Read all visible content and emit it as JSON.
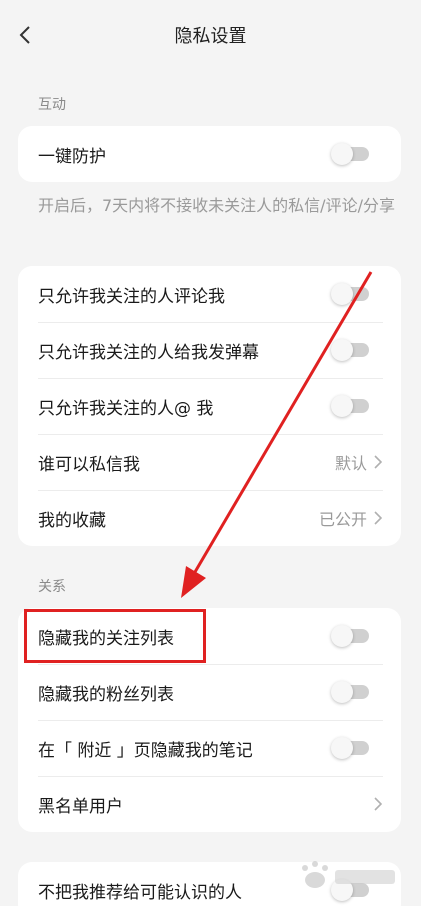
{
  "header": {
    "title": "隐私设置",
    "back_icon": "chevron-left-icon"
  },
  "sections": {
    "interaction_label": "互动",
    "relation_label": "关系"
  },
  "one_key_card": {
    "one_key_label": "一键防护"
  },
  "hint_text": "开启后，7天内将不接收未关注人的私信/评论/分享",
  "interaction_card": {
    "comment_label": "只允许我关注的人评论我",
    "danmu_label": "只允许我关注的人给我发弹幕",
    "mention_label": "只允许我关注的人@ 我",
    "message_label": "谁可以私信我",
    "message_value": "默认",
    "favorites_label": "我的收藏",
    "favorites_value": "已公开"
  },
  "relation_card": {
    "hide_following_label": "隐藏我的关注列表",
    "hide_fans_label": "隐藏我的粉丝列表",
    "nearby_label": "在「 附近 」页隐藏我的笔记",
    "blacklist_label": "黑名单用户"
  },
  "bottom_card": {
    "no_recommend_label": "不把我推荐给可能认识的人"
  },
  "colors": {
    "background": "#f4f4f4",
    "card": "#ffffff",
    "toggle_off_track": "#d0d0d0",
    "annotation_red": "#e02121"
  }
}
